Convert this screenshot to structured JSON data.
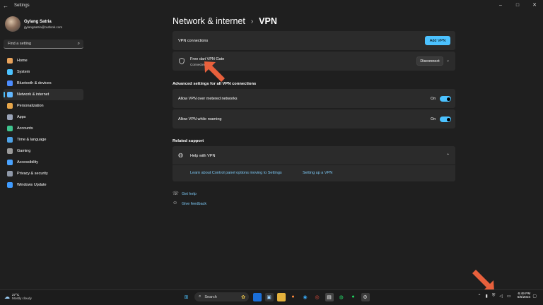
{
  "window": {
    "title": "Settings",
    "controls": {
      "minimize": "–",
      "maximize": "□",
      "close": "✕"
    }
  },
  "profile": {
    "name": "Gylang Satria",
    "email": "gylangsatria@outlook.com"
  },
  "search": {
    "placeholder": "Find a setting"
  },
  "nav": [
    {
      "label": "Home",
      "icon": "home-icon",
      "color": "#e8a35c"
    },
    {
      "label": "System",
      "icon": "system-icon",
      "color": "#4cc2ff"
    },
    {
      "label": "Bluetooth & devices",
      "icon": "bluetooth-icon",
      "color": "#4c8dff"
    },
    {
      "label": "Network & internet",
      "icon": "wifi-icon",
      "color": "#62b8ff",
      "active": true
    },
    {
      "label": "Personalization",
      "icon": "brush-icon",
      "color": "#e7a64a"
    },
    {
      "label": "Apps",
      "icon": "apps-icon",
      "color": "#9aa4b8"
    },
    {
      "label": "Accounts",
      "icon": "person-icon",
      "color": "#3fc58f"
    },
    {
      "label": "Time & language",
      "icon": "globe-clock-icon",
      "color": "#4ea3e8"
    },
    {
      "label": "Gaming",
      "icon": "gamepad-icon",
      "color": "#9a9a9a"
    },
    {
      "label": "Accessibility",
      "icon": "accessibility-icon",
      "color": "#4aa3ff"
    },
    {
      "label": "Privacy & security",
      "icon": "shield-icon",
      "color": "#8f98a8"
    },
    {
      "label": "Windows Update",
      "icon": "update-icon",
      "color": "#3f9bff"
    }
  ],
  "breadcrumb": {
    "parent": "Network & internet",
    "separator": "›",
    "current": "VPN"
  },
  "vpn": {
    "header_label": "VPN connections",
    "add_button": "Add VPN",
    "connection": {
      "name": "Free dari VPN Gate",
      "status": "Connected",
      "disconnect": "Disconnect"
    }
  },
  "advanced": {
    "title": "Advanced settings for all VPN connections",
    "metered": {
      "label": "Allow VPN over metered networks",
      "state": "On"
    },
    "roaming": {
      "label": "Allow VPN while roaming",
      "state": "On"
    }
  },
  "related": {
    "title": "Related support",
    "help_label": "Help with VPN",
    "link1": "Learn about Control panel options moving to Settings",
    "link2": "Setting up a VPN"
  },
  "footer": {
    "get_help": "Get help",
    "feedback": "Give feedback"
  },
  "taskbar": {
    "weather": {
      "temp": "27°C",
      "condition": "Mostly cloudy"
    },
    "search_placeholder": "Search",
    "clock": {
      "time": "6:49 PM",
      "date": "5/5/2024"
    }
  },
  "colors": {
    "accent": "#4cc2ff",
    "annotation_arrow": "#e8603c"
  }
}
